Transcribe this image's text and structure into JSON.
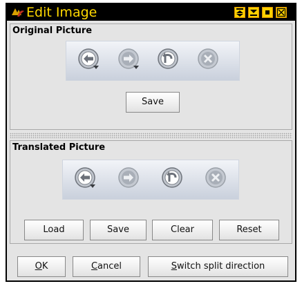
{
  "window": {
    "title": "Edit Image"
  },
  "original": {
    "heading": "Original Picture",
    "save_label": "Save",
    "tools": [
      "back-dropdown-icon",
      "forward-dropdown-icon",
      "rotate-icon",
      "close-circle-icon"
    ]
  },
  "translated": {
    "heading": "Translated Picture",
    "tools": [
      "back-dropdown-icon",
      "forward-icon",
      "rotate-icon",
      "close-circle-icon"
    ],
    "buttons": {
      "load": "Load",
      "save": "Save",
      "clear": "Clear",
      "reset": "Reset"
    }
  },
  "footer": {
    "ok_mnemonic": "O",
    "ok_rest": "K",
    "cancel_mnemonic": "C",
    "cancel_rest": "ancel",
    "switch_mnemonic": "S",
    "switch_rest": "witch split direction"
  },
  "colors": {
    "titlebar": "#000000",
    "title_text": "#ffd800",
    "accent": "#ffd000",
    "panel": "#e4e4e4"
  }
}
